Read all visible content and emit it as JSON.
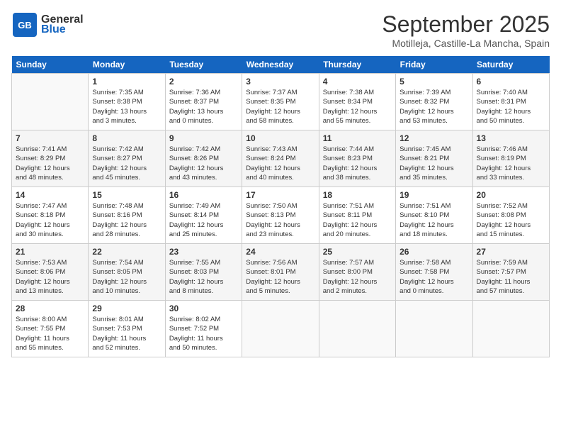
{
  "header": {
    "logo_general": "General",
    "logo_blue": "Blue",
    "month_title": "September 2025",
    "location": "Motilleja, Castille-La Mancha, Spain"
  },
  "days_of_week": [
    "Sunday",
    "Monday",
    "Tuesday",
    "Wednesday",
    "Thursday",
    "Friday",
    "Saturday"
  ],
  "weeks": [
    [
      {
        "day": "",
        "info": ""
      },
      {
        "day": "1",
        "info": "Sunrise: 7:35 AM\nSunset: 8:38 PM\nDaylight: 13 hours\nand 3 minutes."
      },
      {
        "day": "2",
        "info": "Sunrise: 7:36 AM\nSunset: 8:37 PM\nDaylight: 13 hours\nand 0 minutes."
      },
      {
        "day": "3",
        "info": "Sunrise: 7:37 AM\nSunset: 8:35 PM\nDaylight: 12 hours\nand 58 minutes."
      },
      {
        "day": "4",
        "info": "Sunrise: 7:38 AM\nSunset: 8:34 PM\nDaylight: 12 hours\nand 55 minutes."
      },
      {
        "day": "5",
        "info": "Sunrise: 7:39 AM\nSunset: 8:32 PM\nDaylight: 12 hours\nand 53 minutes."
      },
      {
        "day": "6",
        "info": "Sunrise: 7:40 AM\nSunset: 8:31 PM\nDaylight: 12 hours\nand 50 minutes."
      }
    ],
    [
      {
        "day": "7",
        "info": "Sunrise: 7:41 AM\nSunset: 8:29 PM\nDaylight: 12 hours\nand 48 minutes."
      },
      {
        "day": "8",
        "info": "Sunrise: 7:42 AM\nSunset: 8:27 PM\nDaylight: 12 hours\nand 45 minutes."
      },
      {
        "day": "9",
        "info": "Sunrise: 7:42 AM\nSunset: 8:26 PM\nDaylight: 12 hours\nand 43 minutes."
      },
      {
        "day": "10",
        "info": "Sunrise: 7:43 AM\nSunset: 8:24 PM\nDaylight: 12 hours\nand 40 minutes."
      },
      {
        "day": "11",
        "info": "Sunrise: 7:44 AM\nSunset: 8:23 PM\nDaylight: 12 hours\nand 38 minutes."
      },
      {
        "day": "12",
        "info": "Sunrise: 7:45 AM\nSunset: 8:21 PM\nDaylight: 12 hours\nand 35 minutes."
      },
      {
        "day": "13",
        "info": "Sunrise: 7:46 AM\nSunset: 8:19 PM\nDaylight: 12 hours\nand 33 minutes."
      }
    ],
    [
      {
        "day": "14",
        "info": "Sunrise: 7:47 AM\nSunset: 8:18 PM\nDaylight: 12 hours\nand 30 minutes."
      },
      {
        "day": "15",
        "info": "Sunrise: 7:48 AM\nSunset: 8:16 PM\nDaylight: 12 hours\nand 28 minutes."
      },
      {
        "day": "16",
        "info": "Sunrise: 7:49 AM\nSunset: 8:14 PM\nDaylight: 12 hours\nand 25 minutes."
      },
      {
        "day": "17",
        "info": "Sunrise: 7:50 AM\nSunset: 8:13 PM\nDaylight: 12 hours\nand 23 minutes."
      },
      {
        "day": "18",
        "info": "Sunrise: 7:51 AM\nSunset: 8:11 PM\nDaylight: 12 hours\nand 20 minutes."
      },
      {
        "day": "19",
        "info": "Sunrise: 7:51 AM\nSunset: 8:10 PM\nDaylight: 12 hours\nand 18 minutes."
      },
      {
        "day": "20",
        "info": "Sunrise: 7:52 AM\nSunset: 8:08 PM\nDaylight: 12 hours\nand 15 minutes."
      }
    ],
    [
      {
        "day": "21",
        "info": "Sunrise: 7:53 AM\nSunset: 8:06 PM\nDaylight: 12 hours\nand 13 minutes."
      },
      {
        "day": "22",
        "info": "Sunrise: 7:54 AM\nSunset: 8:05 PM\nDaylight: 12 hours\nand 10 minutes."
      },
      {
        "day": "23",
        "info": "Sunrise: 7:55 AM\nSunset: 8:03 PM\nDaylight: 12 hours\nand 8 minutes."
      },
      {
        "day": "24",
        "info": "Sunrise: 7:56 AM\nSunset: 8:01 PM\nDaylight: 12 hours\nand 5 minutes."
      },
      {
        "day": "25",
        "info": "Sunrise: 7:57 AM\nSunset: 8:00 PM\nDaylight: 12 hours\nand 2 minutes."
      },
      {
        "day": "26",
        "info": "Sunrise: 7:58 AM\nSunset: 7:58 PM\nDaylight: 12 hours\nand 0 minutes."
      },
      {
        "day": "27",
        "info": "Sunrise: 7:59 AM\nSunset: 7:57 PM\nDaylight: 11 hours\nand 57 minutes."
      }
    ],
    [
      {
        "day": "28",
        "info": "Sunrise: 8:00 AM\nSunset: 7:55 PM\nDaylight: 11 hours\nand 55 minutes."
      },
      {
        "day": "29",
        "info": "Sunrise: 8:01 AM\nSunset: 7:53 PM\nDaylight: 11 hours\nand 52 minutes."
      },
      {
        "day": "30",
        "info": "Sunrise: 8:02 AM\nSunset: 7:52 PM\nDaylight: 11 hours\nand 50 minutes."
      },
      {
        "day": "",
        "info": ""
      },
      {
        "day": "",
        "info": ""
      },
      {
        "day": "",
        "info": ""
      },
      {
        "day": "",
        "info": ""
      }
    ]
  ]
}
